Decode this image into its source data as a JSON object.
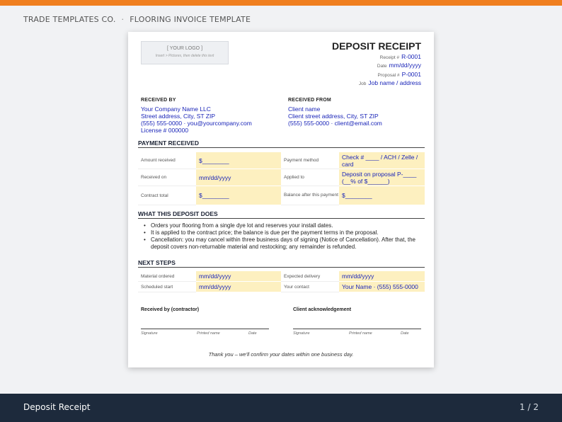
{
  "header": {
    "company": "TRADE TEMPLATES CO.",
    "separator": "·",
    "template_name": "FLOORING INVOICE TEMPLATE"
  },
  "colors": {
    "accent": "#f07f1f",
    "footer": "#1d2a3c",
    "field_fill": "#fdf0c0",
    "field_text": "#1a25b8"
  },
  "document": {
    "logo": {
      "label": "[ YOUR LOGO ]",
      "hint": "Insert > Pictures, then delete this text"
    },
    "title": "DEPOSIT RECEIPT",
    "meta": [
      {
        "label": "Receipt #",
        "value": "R-0001"
      },
      {
        "label": "Date",
        "value": "mm/dd/yyyy"
      },
      {
        "label": "Proposal #",
        "value": "P-0001"
      },
      {
        "label": "Job",
        "value": "Job name / address"
      }
    ],
    "received_by": {
      "heading": "RECEIVED BY",
      "lines": [
        "Your Company Name LLC",
        "Street address, City, ST ZIP",
        "(555) 555-0000 · you@yourcompany.com",
        "License # 000000"
      ]
    },
    "received_from": {
      "heading": "RECEIVED FROM",
      "lines": [
        "Client name",
        "Client street address, City, ST ZIP",
        "(555) 555-0000 · client@email.com"
      ]
    },
    "payment": {
      "heading": "PAYMENT RECEIVED",
      "rows": [
        {
          "label_left": "Amount received",
          "value_left": "$________",
          "label_right": "Payment method",
          "value_right": "Check # ____ / ACH / Zelle / card"
        },
        {
          "label_left": "Received on",
          "value_left": "mm/dd/yyyy",
          "label_right": "Applied to",
          "value_right": "Deposit on proposal P-____ (__% of $______)"
        },
        {
          "label_left": "Contract total",
          "value_left": "$________",
          "label_right": "Balance after this payment",
          "value_right": "$________"
        }
      ]
    },
    "what": {
      "heading": "WHAT THIS DEPOSIT DOES",
      "bullets": [
        "Orders your flooring from a single dye lot and reserves your install dates.",
        "It is applied to the contract price; the balance is due per the payment terms in the proposal.",
        "Cancellation: you may cancel within three business days of signing (Notice of Cancellation). After that, the deposit covers non-returnable material and restocking; any remainder is refunded."
      ]
    },
    "next": {
      "heading": "NEXT STEPS",
      "rows": [
        {
          "label_left": "Material ordered",
          "value_left": "mm/dd/yyyy",
          "label_right": "Expected delivery",
          "value_right": "mm/dd/yyyy"
        },
        {
          "label_left": "Scheduled start",
          "value_left": "mm/dd/yyyy",
          "label_right": "Your contact",
          "value_right": "Your Name · (555) 555-0000"
        }
      ]
    },
    "signatures": {
      "contractor_heading": "Received by (contractor)",
      "client_heading": "Client acknowledgement",
      "labels": [
        "Signature",
        "Printed name",
        "Date"
      ]
    },
    "thanks": "Thank you – we'll confirm your dates within one business day."
  },
  "footer": {
    "title": "Deposit Receipt",
    "page": "1 / 2"
  }
}
